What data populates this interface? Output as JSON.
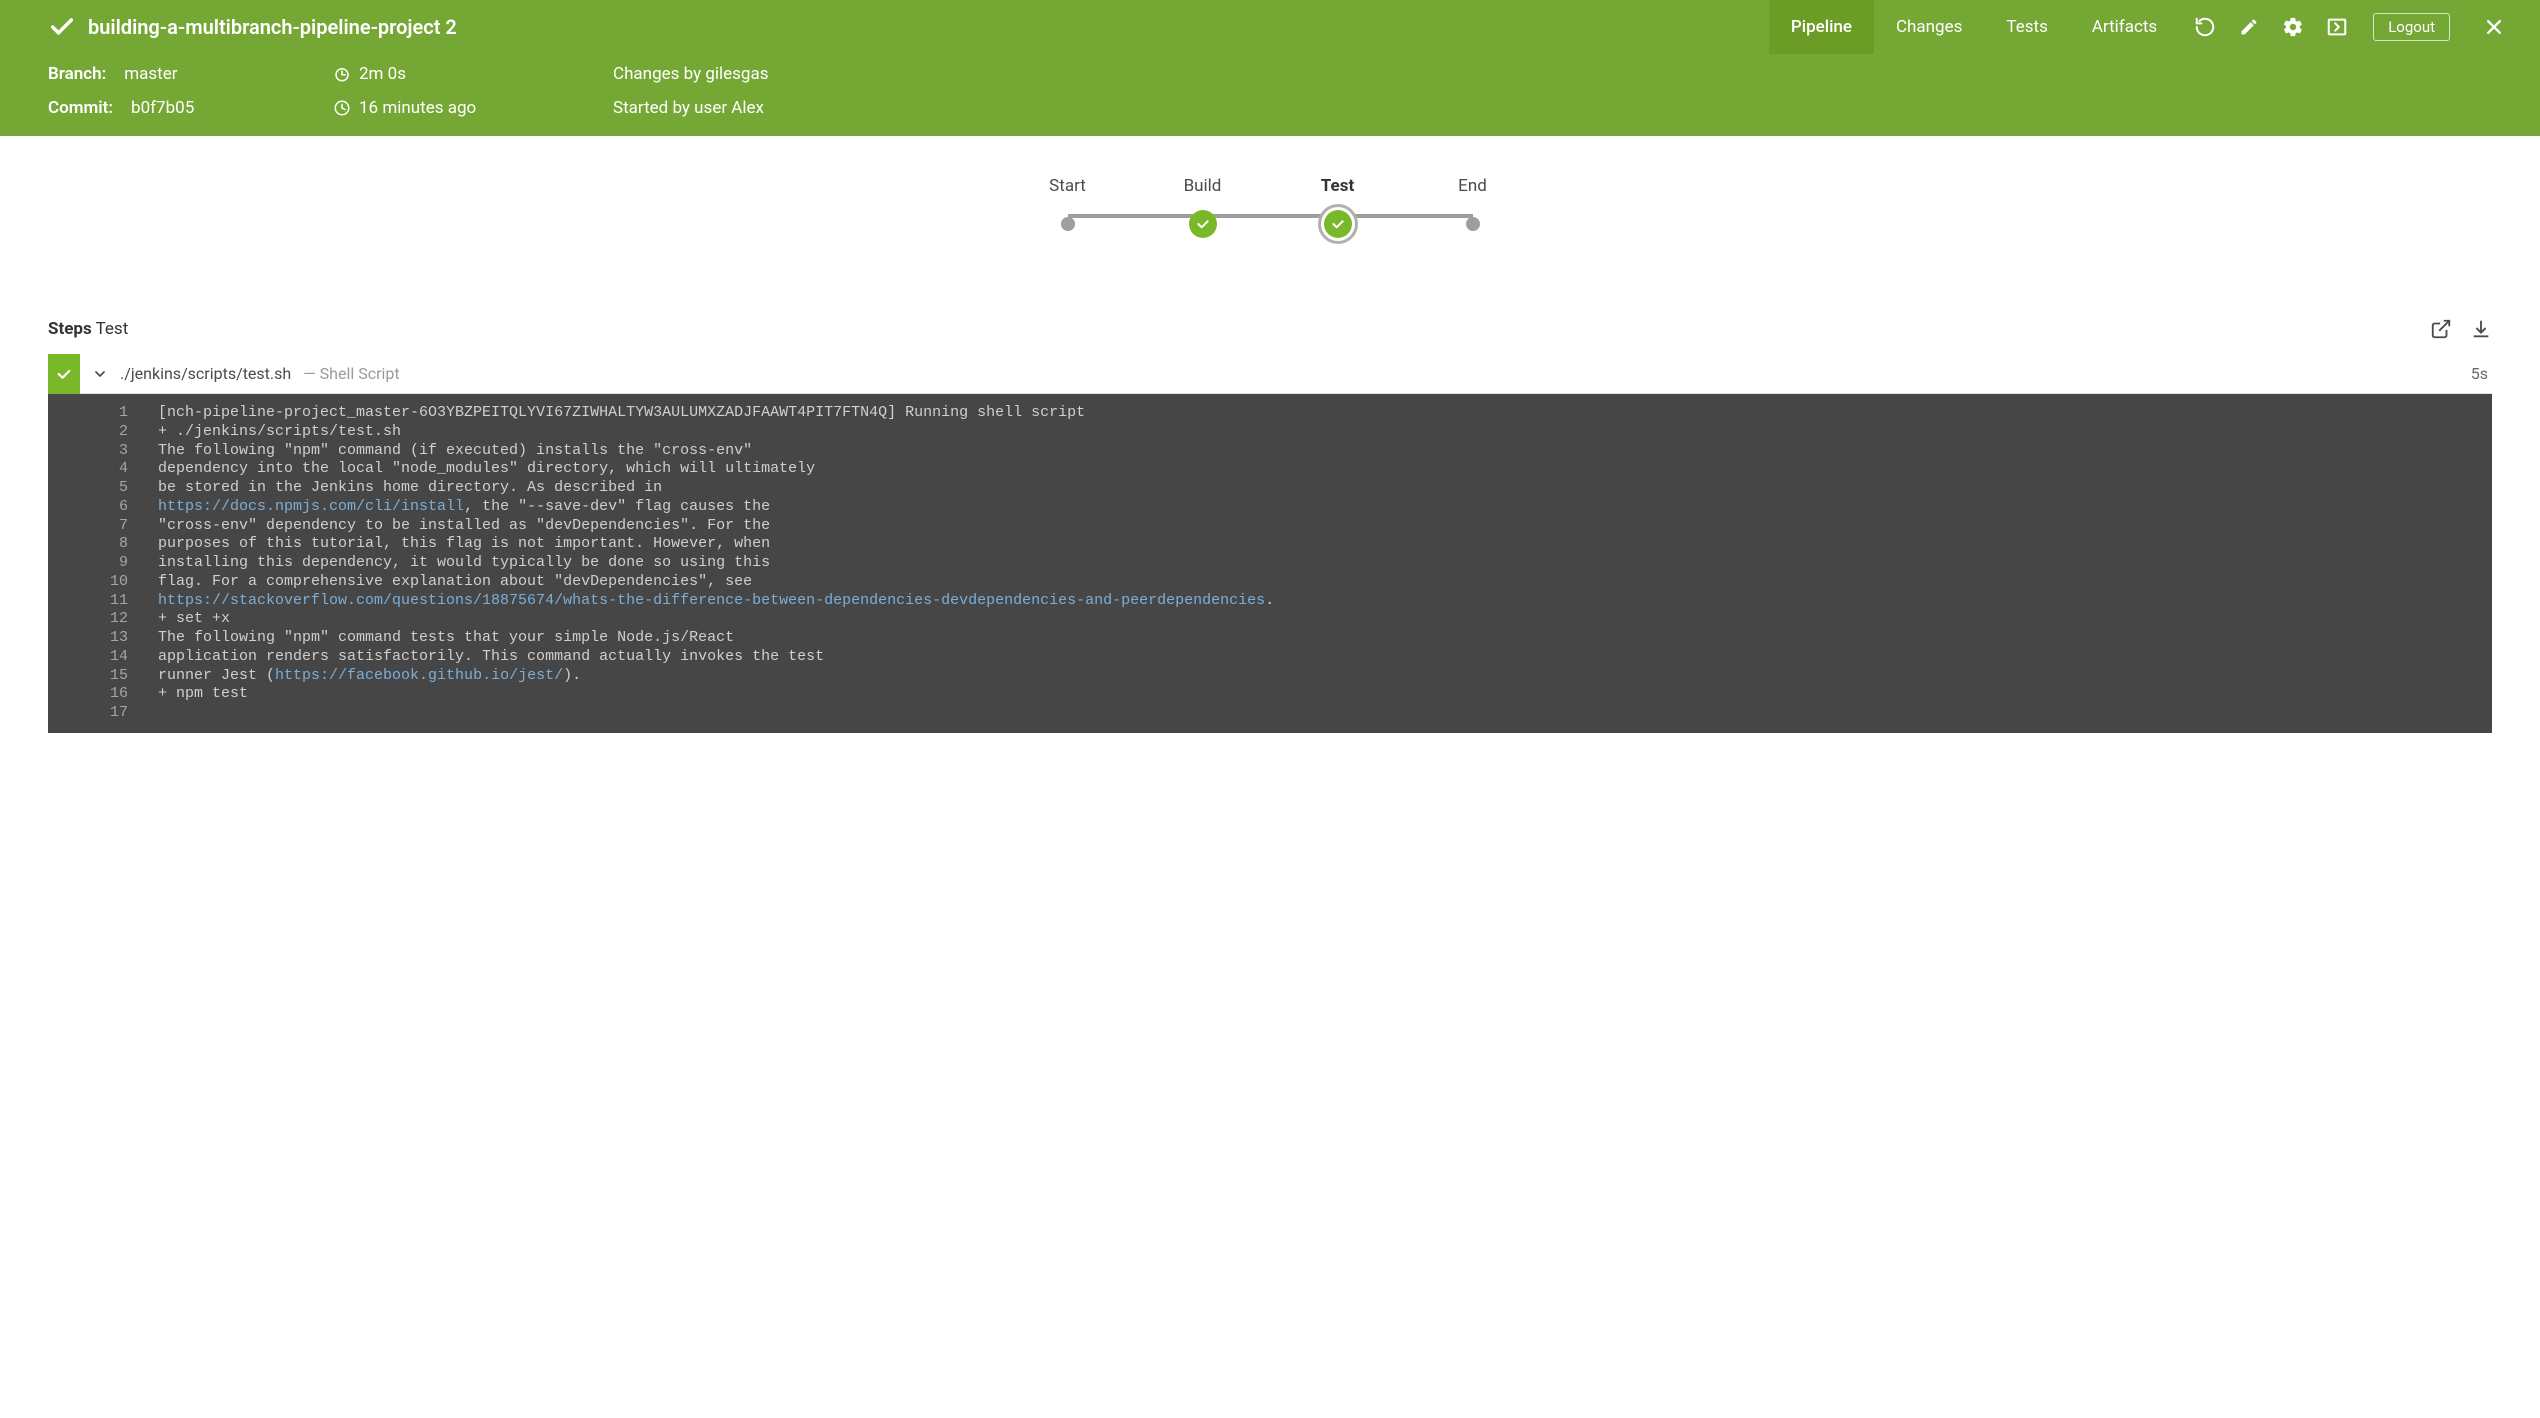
{
  "header": {
    "title": "building-a-multibranch-pipeline-project 2",
    "tabs": [
      "Pipeline",
      "Changes",
      "Tests",
      "Artifacts"
    ],
    "active_tab": 0,
    "logout_label": "Logout"
  },
  "meta": {
    "branch_label": "Branch:",
    "branch_value": "master",
    "commit_label": "Commit:",
    "commit_value": "b0f7b05",
    "duration": "2m 0s",
    "time_ago": "16 minutes ago",
    "changes_by": "Changes by gilesgas",
    "started_by": "Started by user Alex"
  },
  "stages": [
    {
      "label": "Start",
      "type": "dot",
      "active": false
    },
    {
      "label": "Build",
      "type": "check",
      "active": false
    },
    {
      "label": "Test",
      "type": "check",
      "active": true
    },
    {
      "label": "End",
      "type": "dot",
      "active": false
    }
  ],
  "steps": {
    "title_prefix": "Steps",
    "title_stage": "Test",
    "item": {
      "command": "./jenkins/scripts/test.sh",
      "description": "— Shell Script",
      "duration": "5s"
    }
  },
  "console": {
    "lines": [
      {
        "n": 1,
        "segments": [
          {
            "t": "[nch-pipeline-project_master-6O3YBZPEITQLYVI67ZIWHALTYW3AULUMXZADJFAAWT4PIT7FTN4Q] Running shell script"
          }
        ]
      },
      {
        "n": 2,
        "segments": [
          {
            "t": "+ ./jenkins/scripts/test.sh"
          }
        ]
      },
      {
        "n": 3,
        "segments": [
          {
            "t": "The following \"npm\" command (if executed) installs the \"cross-env\""
          }
        ]
      },
      {
        "n": 4,
        "segments": [
          {
            "t": "dependency into the local \"node_modules\" directory, which will ultimately"
          }
        ]
      },
      {
        "n": 5,
        "segments": [
          {
            "t": "be stored in the Jenkins home directory. As described in"
          }
        ]
      },
      {
        "n": 6,
        "segments": [
          {
            "t": "https://docs.npmjs.com/cli/install",
            "link": true
          },
          {
            "t": ", the \"--save-dev\" flag causes the"
          }
        ]
      },
      {
        "n": 7,
        "segments": [
          {
            "t": "\"cross-env\" dependency to be installed as \"devDependencies\". For the"
          }
        ]
      },
      {
        "n": 8,
        "segments": [
          {
            "t": "purposes of this tutorial, this flag is not important. However, when"
          }
        ]
      },
      {
        "n": 9,
        "segments": [
          {
            "t": "installing this dependency, it would typically be done so using this"
          }
        ]
      },
      {
        "n": 10,
        "segments": [
          {
            "t": "flag. For a comprehensive explanation about \"devDependencies\", see"
          }
        ]
      },
      {
        "n": 11,
        "segments": [
          {
            "t": "https://stackoverflow.com/questions/18875674/whats-the-difference-between-dependencies-devdependencies-and-peerdependencies",
            "link": true
          },
          {
            "t": "."
          }
        ]
      },
      {
        "n": 12,
        "segments": [
          {
            "t": "+ set +x"
          }
        ]
      },
      {
        "n": 13,
        "segments": [
          {
            "t": "The following \"npm\" command tests that your simple Node.js/React"
          }
        ]
      },
      {
        "n": 14,
        "segments": [
          {
            "t": "application renders satisfactorily. This command actually invokes the test"
          }
        ]
      },
      {
        "n": 15,
        "segments": [
          {
            "t": "runner Jest ("
          },
          {
            "t": "https://facebook.github.io/jest/",
            "link": true
          },
          {
            "t": ")."
          }
        ]
      },
      {
        "n": 16,
        "segments": [
          {
            "t": "+ npm test"
          }
        ]
      },
      {
        "n": 17,
        "segments": [
          {
            "t": ""
          }
        ]
      }
    ]
  }
}
